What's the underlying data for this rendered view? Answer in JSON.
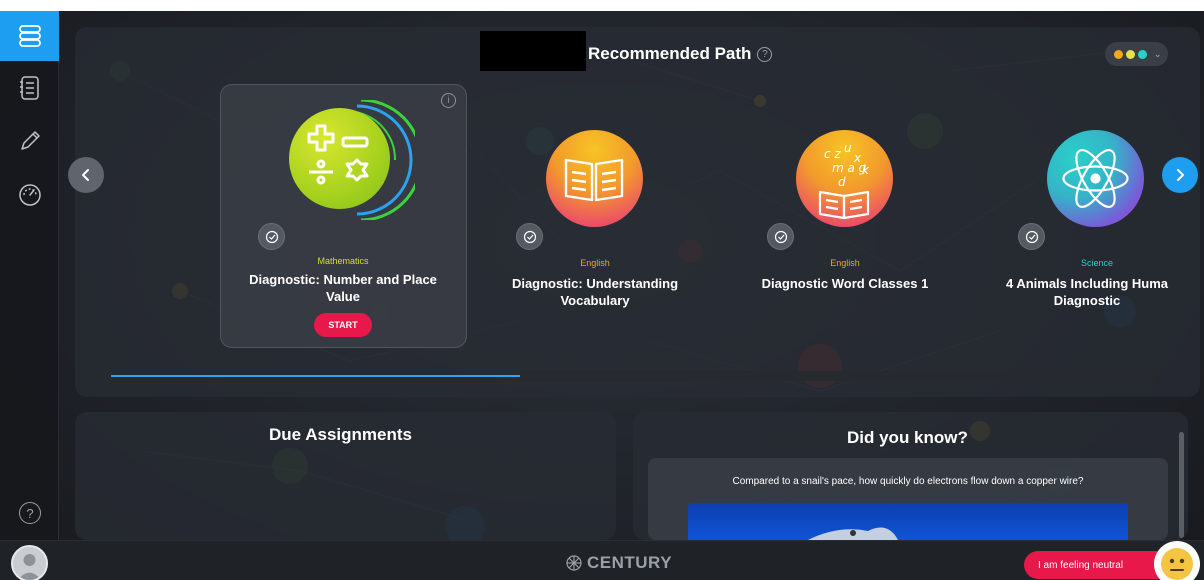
{
  "header": {
    "title": "Recommended Path",
    "help_glyph": "?",
    "theme_colors": [
      "#f5a623",
      "#e8e04a",
      "#2ad0c8"
    ]
  },
  "sidebar": {
    "items": [
      {
        "name": "path-icon",
        "active": true
      },
      {
        "name": "notebook-icon",
        "active": false
      },
      {
        "name": "pencil-icon",
        "active": false
      },
      {
        "name": "dashboard-icon",
        "active": false
      }
    ],
    "help_glyph": "?"
  },
  "courses": [
    {
      "subject": "Mathematics",
      "title": "Diagnostic: Number and Place Value",
      "subject_color": "#d4e02a",
      "start_label": "START",
      "info_glyph": "i"
    },
    {
      "subject": "English",
      "title": "Diagnostic: Understanding Vocabulary",
      "subject_color": "#f5a623"
    },
    {
      "subject": "English",
      "title": "Diagnostic Word Classes 1",
      "subject_color": "#f5a623"
    },
    {
      "subject": "Science",
      "title": "4 Animals Including Huma Diagnostic",
      "subject_color": "#2ad0c8"
    }
  ],
  "path_progress": 0.39,
  "due_assignments": {
    "heading": "Due Assignments"
  },
  "did_you_know": {
    "heading": "Did you know?",
    "question": "Compared to a snail's pace, how quickly do electrons flow down a copper wire?"
  },
  "footer": {
    "logo_text": "CENTURY",
    "mood_label": "I am feeling neutral"
  }
}
